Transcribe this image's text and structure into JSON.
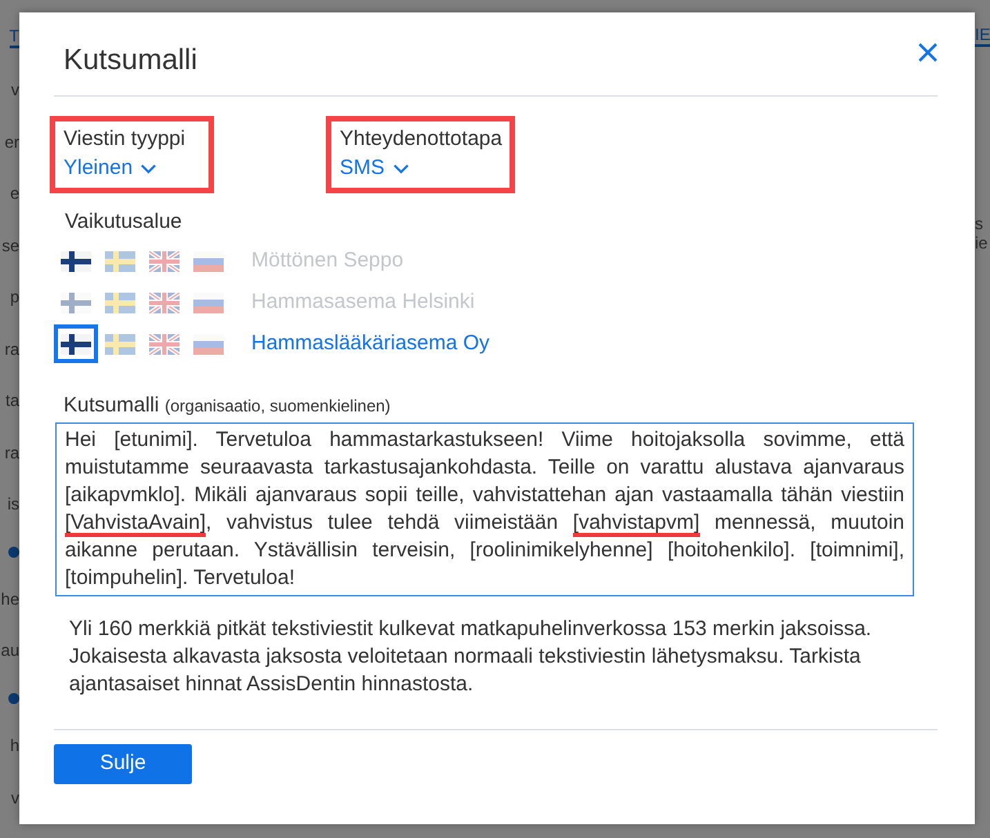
{
  "background": {
    "left": [
      {
        "kind": "tab",
        "text": "T"
      },
      {
        "kind": "text",
        "text": "v"
      },
      {
        "kind": "text",
        "text": "er"
      },
      {
        "kind": "text",
        "text": "e"
      },
      {
        "kind": "text",
        "text": "se"
      },
      {
        "kind": "text",
        "text": "p"
      },
      {
        "kind": "text",
        "text": "ra"
      },
      {
        "kind": "text",
        "text": "ta"
      },
      {
        "kind": "text",
        "text": "ra"
      },
      {
        "kind": "text",
        "text": "is"
      },
      {
        "kind": "dot"
      },
      {
        "kind": "text",
        "text": "he"
      },
      {
        "kind": "text",
        "text": "au"
      },
      {
        "kind": "dot"
      },
      {
        "kind": "text",
        "text": "h"
      },
      {
        "kind": "text",
        "text": "v"
      }
    ],
    "right": [
      {
        "kind": "tab",
        "text": "IE"
      },
      {
        "kind": "text",
        "text": "s"
      },
      {
        "kind": "text",
        "text": "ie"
      }
    ]
  },
  "dialog": {
    "title": "Kutsumalli",
    "fields": [
      {
        "label": "Viestin tyyppi",
        "value": "Yleinen",
        "highlighted": true
      },
      {
        "label": "Yhteydenottotapa",
        "value": "SMS",
        "highlighted": true
      }
    ],
    "scope": {
      "label": "Vaikutusalue",
      "rows": [
        {
          "name": "Möttönen Seppo",
          "selected": false,
          "flags": [
            {
              "kind": "fi",
              "active": true,
              "selected": false
            },
            {
              "kind": "se",
              "active": false,
              "selected": false
            },
            {
              "kind": "gb",
              "active": false,
              "selected": false
            },
            {
              "kind": "ru",
              "active": false,
              "selected": false
            }
          ]
        },
        {
          "name": "Hammasasema Helsinki",
          "selected": false,
          "flags": [
            {
              "kind": "fi",
              "active": false,
              "selected": false
            },
            {
              "kind": "se",
              "active": false,
              "selected": false
            },
            {
              "kind": "gb",
              "active": false,
              "selected": false
            },
            {
              "kind": "ru",
              "active": false,
              "selected": false
            }
          ]
        },
        {
          "name": "Hammaslääkäriasema Oy",
          "selected": true,
          "flags": [
            {
              "kind": "fi",
              "active": true,
              "selected": true
            },
            {
              "kind": "se",
              "active": false,
              "selected": false
            },
            {
              "kind": "gb",
              "active": false,
              "selected": false
            },
            {
              "kind": "ru",
              "active": false,
              "selected": false
            }
          ]
        }
      ]
    },
    "template": {
      "label": "Kutsumalli",
      "note": "(organisaatio, suomenkielinen)",
      "segments": [
        {
          "kind": "plain",
          "text": "Hei [etunimi]. Tervetuloa hammastarkastukseen! Viime hoitojaksolla sovimme, että muistutamme seuraavasta tarkastusajankohdasta. Teille on varattu alustava ajanvaraus [aikapvmklo]. Mikäli ajanvaraus sopii teille, vahvistattehan ajan vastaamalla tähän viestiin "
        },
        {
          "kind": "underlined",
          "text": "[VahvistaAvain]"
        },
        {
          "kind": "plain",
          "text": ", vahvistus tulee tehdä viimeistään "
        },
        {
          "kind": "underlined",
          "text": "[vahvistapvm]"
        },
        {
          "kind": "plain",
          "text": " mennessä, muutoin aikanne perutaan. Ystävällisin terveisin, [roolinimikelyhenne] [hoitohenkilo]. [toimnimi], [toimpuhelin]. Tervetuloa!"
        }
      ]
    },
    "info": "Yli 160 merkkiä pitkät tekstiviestit kulkevat matkapuhelinverkossa 153 merkin jaksoissa. Jokaisesta alkavasta jaksosta veloitetaan normaali tekstiviestin lähetysmaksu. Tarkista ajantasaiset hinnat AssisDentin hinnastosta.",
    "buttons": [
      {
        "label": "Sulje"
      }
    ]
  }
}
